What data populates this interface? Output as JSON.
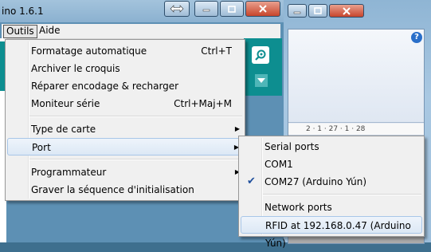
{
  "background_window": {
    "ruler_text": "2 · 1 · 27 · 1 · 28",
    "help_label": "?"
  },
  "main_window": {
    "title": "ino 1.6.1"
  },
  "menubar": {
    "items": [
      {
        "label": "Outils"
      },
      {
        "label": "Aide"
      }
    ]
  },
  "tools_menu": {
    "items": [
      {
        "label": "Formatage automatique",
        "shortcut": "Ctrl+T"
      },
      {
        "label": "Archiver le croquis",
        "shortcut": ""
      },
      {
        "label": "Réparer encodage & recharger",
        "shortcut": ""
      },
      {
        "label": "Moniteur série",
        "shortcut": "Ctrl+Maj+M"
      },
      {
        "label": "Type de carte",
        "shortcut": ""
      },
      {
        "label": "Port",
        "shortcut": ""
      },
      {
        "label": "Programmateur",
        "shortcut": ""
      },
      {
        "label": "Graver la séquence d'initialisation",
        "shortcut": ""
      }
    ]
  },
  "port_menu": {
    "items": [
      {
        "label": "Serial ports"
      },
      {
        "label": "COM1"
      },
      {
        "label": "COM27 (Arduino Yún)",
        "checked": true
      },
      {
        "label": "Network ports"
      },
      {
        "label": "RFID at 192.168.0.47 (Arduino Yún)"
      }
    ],
    "check_glyph": "✔"
  },
  "colors": {
    "arduino_teal": "#0d8e90",
    "highlight_border": "#a8c6e8"
  }
}
